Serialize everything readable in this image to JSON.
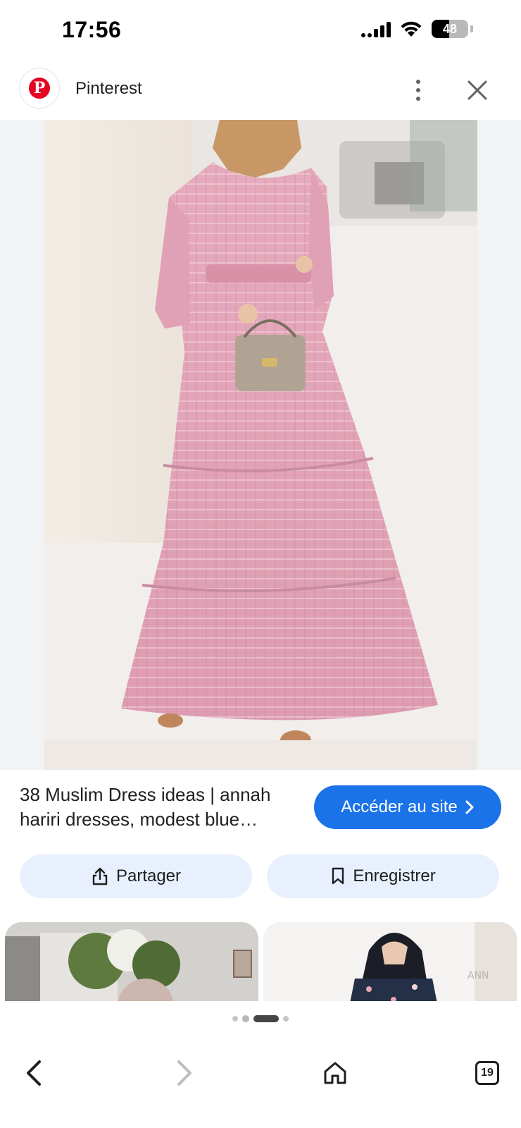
{
  "status_bar": {
    "time": "17:56",
    "battery_level": "48",
    "icons": [
      "signal-icon",
      "wifi-icon",
      "battery-icon"
    ]
  },
  "header": {
    "site_name": "Pinterest",
    "logo_icon": "pinterest-logo",
    "more_icon": "more-vert-icon",
    "close_icon": "close-icon",
    "brand_color": "#e60023"
  },
  "result": {
    "caption": "38 Muslim Dress ideas | annah hariri dresses, modest blue…",
    "visit_label": "Accéder au site",
    "visit_icon": "chevron-right-icon",
    "accent_color": "#1a73e8"
  },
  "actions": {
    "share_label": "Partager",
    "share_icon": "share-icon",
    "save_label": "Enregistrer",
    "save_icon": "bookmark-icon"
  },
  "carousel": {
    "page_count": 4,
    "active_index": 2
  },
  "bottom_nav": {
    "back_icon": "back-icon",
    "forward_icon": "forward-icon",
    "home_icon": "home-icon",
    "tab_count": "19"
  }
}
